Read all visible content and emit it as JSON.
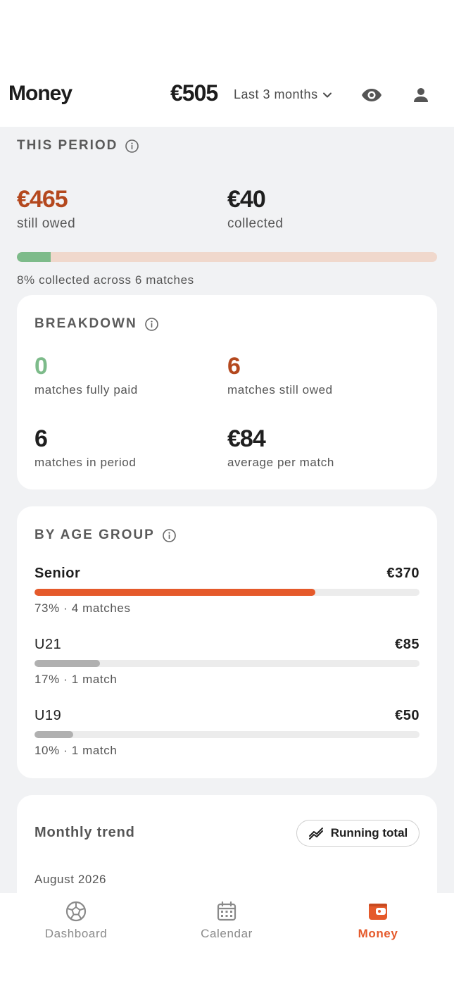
{
  "header": {
    "title": "Money",
    "total": "€505",
    "period_label": "Last 3 months",
    "icons": {
      "period": "chevron-down-icon",
      "visibility": "eye-icon",
      "profile": "user-icon"
    }
  },
  "this_period": {
    "title": "THIS PERIOD",
    "owed_amount": "€465",
    "owed_label": "still owed",
    "collected_amount": "€40",
    "collected_label": "collected",
    "collected_fraction": 0.08,
    "progress_note": "8% collected across 6 matches"
  },
  "breakdown": {
    "title": "BREAKDOWN",
    "stats": [
      {
        "value": "0",
        "label": "matches fully paid"
      },
      {
        "value": "6",
        "label": "matches still owed"
      },
      {
        "value": "6",
        "label": "matches in period"
      },
      {
        "value": "€84",
        "label": "average per match"
      }
    ]
  },
  "age_groups": {
    "title": "BY AGE GROUP",
    "items": [
      {
        "name": "Senior",
        "amount": "€370",
        "share": 0.73,
        "meta": "73% · 4 matches"
      },
      {
        "name": "U21",
        "amount": "€85",
        "share": 0.17,
        "meta": "17% · 1 match"
      },
      {
        "name": "U19",
        "amount": "€50",
        "share": 0.1,
        "meta": "10% · 1 match"
      }
    ]
  },
  "trend": {
    "title": "Monthly trend",
    "toggle_label": "Running total",
    "month": "August 2026"
  },
  "tabbar": {
    "tabs": [
      {
        "label": "Dashboard",
        "icon": "soccer-ball-icon",
        "active": false
      },
      {
        "label": "Calendar",
        "icon": "calendar-icon",
        "active": false
      },
      {
        "label": "Money",
        "icon": "wallet-icon",
        "active": true
      }
    ]
  },
  "colors": {
    "accent": "#e55a2b",
    "owed": "#b4481e",
    "paid": "#7dbb8a",
    "owed_track": "#f0d8cc",
    "bar_secondary": "#b0b0b0"
  }
}
